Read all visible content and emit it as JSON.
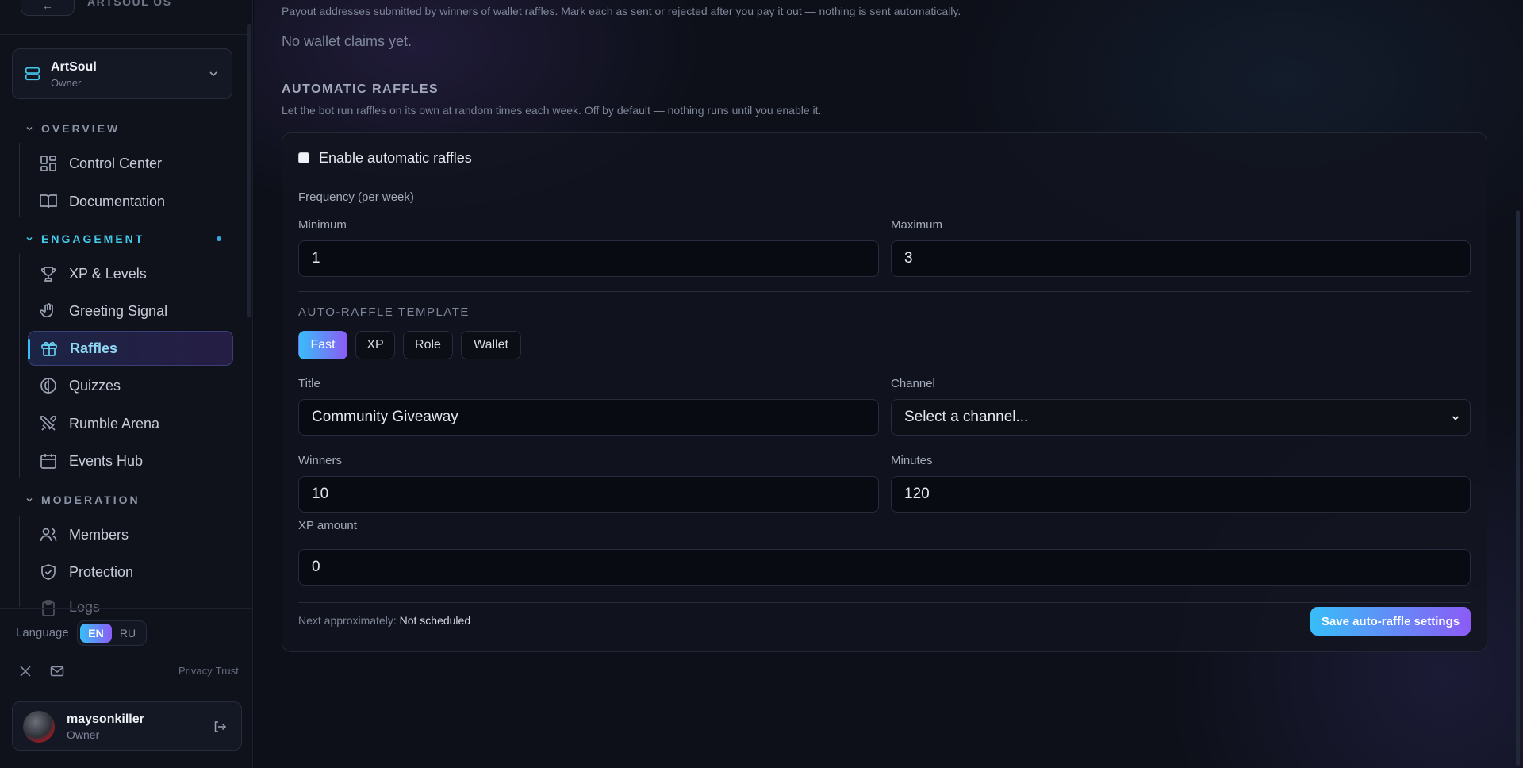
{
  "brand": {
    "name": "ARTSOUL OS",
    "back_glyph": "←"
  },
  "server": {
    "name": "ArtSoul",
    "role": "Owner"
  },
  "sections": {
    "overview": "OVERVIEW",
    "engagement": "ENGAGEMENT",
    "moderation": "MODERATION"
  },
  "nav": {
    "control_center": "Control Center",
    "documentation": "Documentation",
    "xp_levels": "XP & Levels",
    "greeting_signal": "Greeting Signal",
    "raffles": "Raffles",
    "quizzes": "Quizzes",
    "rumble_arena": "Rumble Arena",
    "events_hub": "Events Hub",
    "members": "Members",
    "protection": "Protection",
    "logs": "Logs"
  },
  "language": {
    "label": "Language",
    "options": [
      "EN",
      "RU"
    ],
    "selected": "EN"
  },
  "legal": {
    "privacy": "Privacy",
    "trust": "Trust"
  },
  "user": {
    "name": "maysonkiller",
    "role": "Owner"
  },
  "claims": {
    "description": "Payout addresses submitted by winners of wallet raffles. Mark each as sent or rejected after you pay it out — nothing is sent automatically.",
    "empty": "No wallet claims yet."
  },
  "auto": {
    "title": "AUTOMATIC RAFFLES",
    "description": "Let the bot run raffles on its own at random times each week. Off by default — nothing runs until you enable it.",
    "enable_label": "Enable automatic raffles",
    "enabled": false,
    "frequency_label": "Frequency (per week)",
    "minimum_label": "Minimum",
    "minimum_value": "1",
    "maximum_label": "Maximum",
    "maximum_value": "3",
    "template_label": "AUTO-RAFFLE TEMPLATE",
    "templates": [
      "Fast",
      "XP",
      "Role",
      "Wallet"
    ],
    "selected_template": "Fast",
    "title_label": "Title",
    "title_value": "Community Giveaway",
    "channel_label": "Channel",
    "channel_value": "Select a channel...",
    "winners_label": "Winners",
    "winners_value": "10",
    "minutes_label": "Minutes",
    "minutes_value": "120",
    "xp_label": "XP amount",
    "xp_value": "0",
    "next_label": "Next approximately:",
    "next_value": "Not scheduled",
    "save_label": "Save auto-raffle settings"
  },
  "colors": {
    "accent_cyan": "#38bdf8",
    "accent_violet": "#8b5cf6",
    "engagement_heading": "#44c8ea",
    "background": "#0d1019"
  }
}
